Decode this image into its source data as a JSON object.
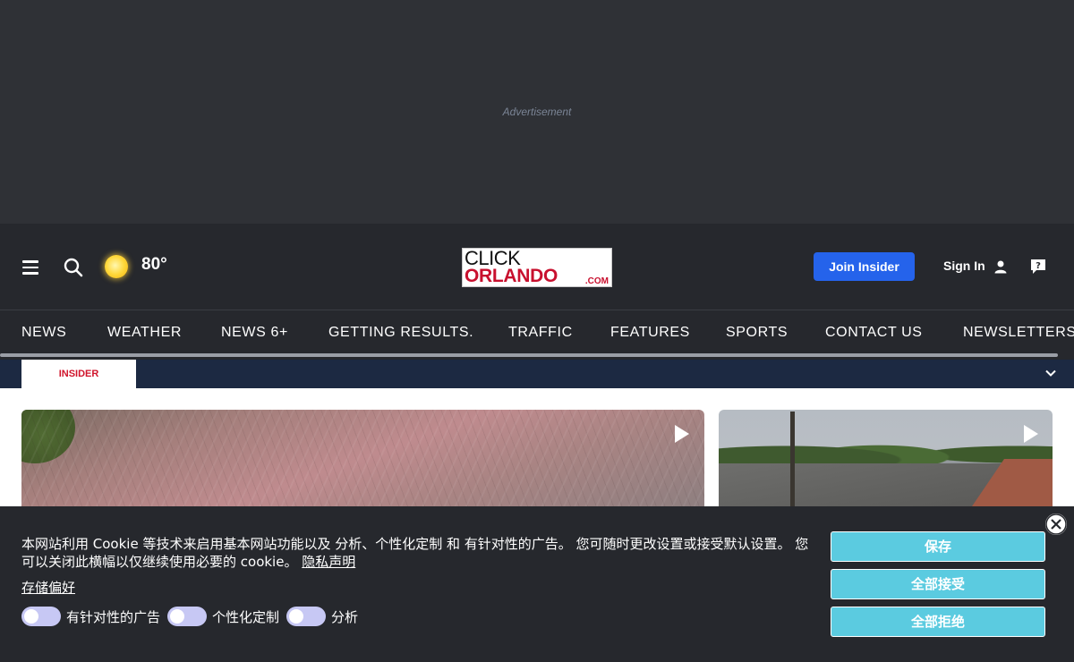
{
  "ad": {
    "label": "Advertisement"
  },
  "header": {
    "weather": {
      "icon": "sun-icon",
      "temp": "80°"
    },
    "logo": {
      "line1": "CLICK",
      "line2": "ORLANDO",
      "suffix": ".COM"
    },
    "join_label": "Join Insider",
    "signin_label": "Sign In"
  },
  "nav": {
    "items": [
      "NEWS",
      "WEATHER",
      "NEWS 6+",
      "GETTING RESULTS.",
      "TRAFFIC",
      "FEATURES",
      "SPORTS",
      "CONTACT US",
      "NEWSLETTERS"
    ]
  },
  "insider": {
    "tab_label": "INSIDER"
  },
  "cookie": {
    "text": "本网站利用 Cookie 等技术来启用基本网站功能以及 分析、个性化定制 和 有针对性的广告。 您可随时更改设置或接受默认设置。 您可以关闭此横幅以仅继续使用必要的 cookie。",
    "privacy_link": "隐私声明",
    "pref_link": "存储偏好",
    "toggles": [
      "有针对性的广告",
      "个性化定制",
      "分析"
    ],
    "buttons": {
      "save": "保存",
      "accept_all": "全部接受",
      "reject_all": "全部拒绝"
    }
  },
  "colors": {
    "join_blue": "#2563eb",
    "cookie_button": "#5bcbe0",
    "insider_red": "#d0142b",
    "insider_bar": "#1c2942"
  }
}
